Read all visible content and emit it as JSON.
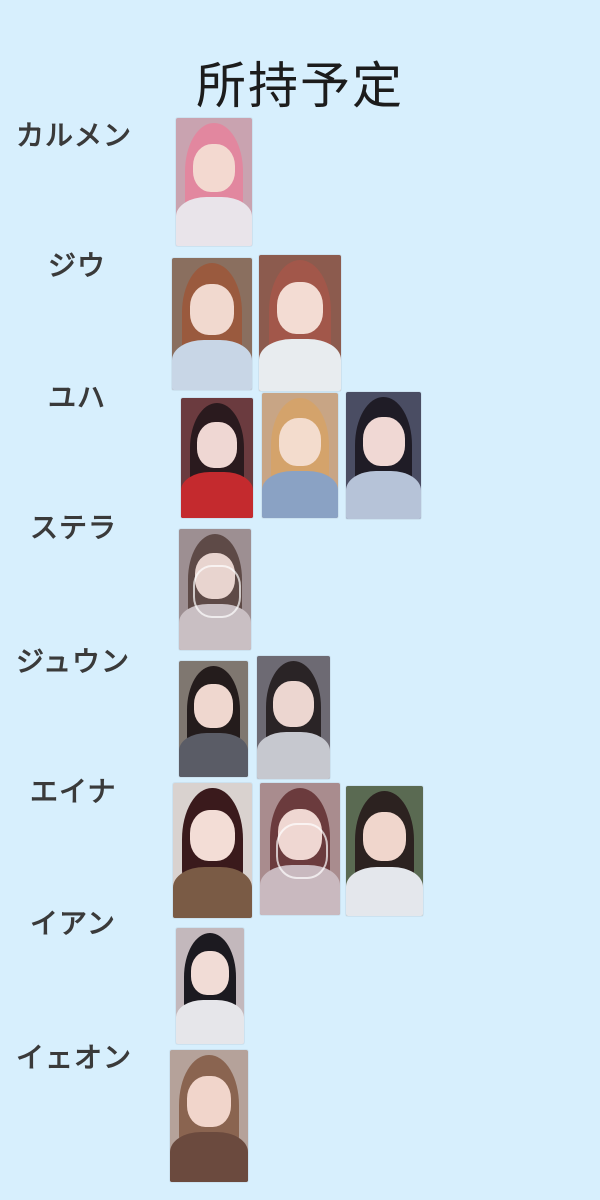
{
  "title": "所持予定",
  "members": [
    {
      "name": "カルメン",
      "cards": [
        {
          "bg": "#c9a3b0",
          "hair": "#e2879f",
          "face": "#f3d9d0",
          "body": "#e9e4ea"
        }
      ]
    },
    {
      "name": "ジウ",
      "cards": [
        {
          "bg": "#8a6f5f",
          "hair": "#9a5a3e",
          "face": "#f1d9cf",
          "body": "#c8d6e6"
        },
        {
          "bg": "#8c5b4e",
          "hair": "#a2574a",
          "face": "#f3dcd3",
          "body": "#e8ecef"
        }
      ]
    },
    {
      "name": "ユハ",
      "cards": [
        {
          "bg": "#6b3b3f",
          "hair": "#2a1a1e",
          "face": "#efd7d3",
          "body": "#c42a2e"
        },
        {
          "bg": "#c8a585",
          "hair": "#d4a36b",
          "face": "#f3dccd",
          "body": "#8aa2c4"
        },
        {
          "bg": "#4a4d63",
          "hair": "#1f1c26",
          "face": "#f0d8d4",
          "body": "#b6c3d8"
        }
      ]
    },
    {
      "name": "ステラ",
      "cards": [
        {
          "bg": "#9d8f92",
          "hair": "#5e4a47",
          "face": "#e8d4cf",
          "body": "#c9bfc3",
          "deco": true
        }
      ]
    },
    {
      "name": "ジュウン",
      "cards": [
        {
          "bg": "#7f7770",
          "hair": "#241c1c",
          "face": "#efd7cf",
          "body": "#5a5c66"
        },
        {
          "bg": "#6d6a73",
          "hair": "#2a2426",
          "face": "#ecd6d0",
          "body": "#c6c8cf"
        }
      ]
    },
    {
      "name": "エイナ",
      "cards": [
        {
          "bg": "#d9d2cf",
          "hair": "#3a1a1c",
          "face": "#f3ddd6",
          "body": "#7a5b45"
        },
        {
          "bg": "#a98c8e",
          "hair": "#6b3b3d",
          "face": "#efd7d2",
          "body": "#c9b9bf",
          "deco": true
        },
        {
          "bg": "#5a6a52",
          "hair": "#2c2220",
          "face": "#f0d6cc",
          "body": "#e4e7ec"
        }
      ]
    },
    {
      "name": "イアン",
      "cards": [
        {
          "bg": "#c3b8bc",
          "hair": "#1c1a20",
          "face": "#f1dcd6",
          "body": "#e6e6ea"
        }
      ]
    },
    {
      "name": "イェオン",
      "cards": [
        {
          "bg": "#b5a29a",
          "hair": "#8a6450",
          "face": "#f1d5cb",
          "body": "#6b4a3e"
        }
      ]
    }
  ]
}
